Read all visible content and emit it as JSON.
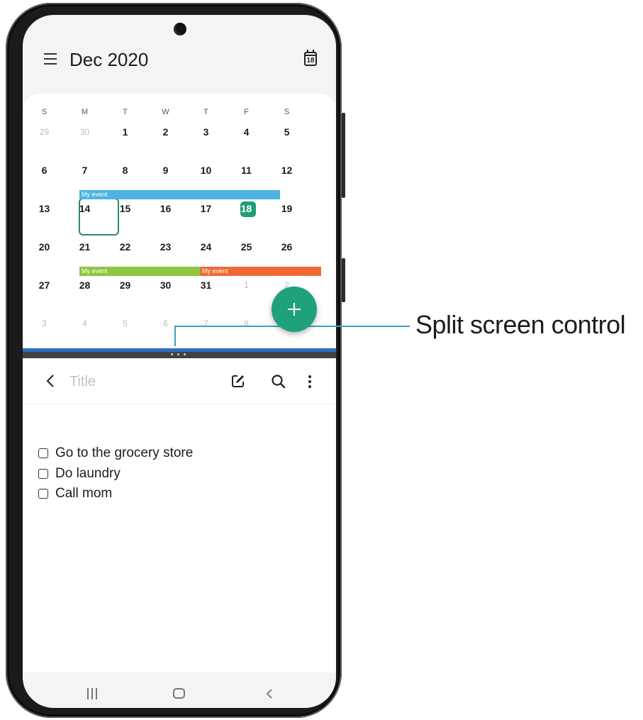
{
  "calendar": {
    "month_title": "Dec 2020",
    "today_icon_number": "18",
    "weekdays": [
      "S",
      "M",
      "T",
      "W",
      "T",
      "F",
      "S"
    ],
    "weeks": [
      [
        {
          "d": "29",
          "m": true
        },
        {
          "d": "30",
          "m": true
        },
        {
          "d": "1"
        },
        {
          "d": "2"
        },
        {
          "d": "3"
        },
        {
          "d": "4"
        },
        {
          "d": "5"
        }
      ],
      [
        {
          "d": "6"
        },
        {
          "d": "7"
        },
        {
          "d": "8"
        },
        {
          "d": "9"
        },
        {
          "d": "10"
        },
        {
          "d": "11"
        },
        {
          "d": "12"
        }
      ],
      [
        {
          "d": "13"
        },
        {
          "d": "14"
        },
        {
          "d": "15"
        },
        {
          "d": "16"
        },
        {
          "d": "17"
        },
        {
          "d": "18",
          "today": true
        },
        {
          "d": "19"
        }
      ],
      [
        {
          "d": "20"
        },
        {
          "d": "21"
        },
        {
          "d": "22"
        },
        {
          "d": "23"
        },
        {
          "d": "24"
        },
        {
          "d": "25"
        },
        {
          "d": "26"
        }
      ],
      [
        {
          "d": "27"
        },
        {
          "d": "28"
        },
        {
          "d": "29"
        },
        {
          "d": "30"
        },
        {
          "d": "31"
        },
        {
          "d": "1",
          "m": true
        },
        {
          "d": "2",
          "m": true
        }
      ],
      [
        {
          "d": "3",
          "m": true
        },
        {
          "d": "4",
          "m": true
        },
        {
          "d": "5",
          "m": true
        },
        {
          "d": "6",
          "m": true
        },
        {
          "d": "7",
          "m": true
        },
        {
          "d": "8",
          "m": true
        },
        {
          "d": "9",
          "m": true
        }
      ]
    ],
    "events": [
      {
        "label": "My event",
        "color": "#4db3e2"
      },
      {
        "label": "My event",
        "color": "#8cc63f"
      },
      {
        "label": "My event",
        "color": "#ef6a35"
      }
    ],
    "selected_day": "14",
    "today": "18",
    "accent_color": "#1fa17c"
  },
  "notes": {
    "title_placeholder": "Title",
    "items": [
      {
        "label": "Go to the grocery store",
        "checked": false
      },
      {
        "label": "Do laundry",
        "checked": false
      },
      {
        "label": "Call mom",
        "checked": false
      }
    ]
  },
  "icons": {
    "menu": "hamburger-menu-icon",
    "today": "calendar-today-icon",
    "fab": "plus-icon",
    "back": "chevron-left-icon",
    "draw": "pen-edit-icon",
    "search": "search-icon",
    "more": "more-vertical-icon",
    "nav_recents": "recents-icon",
    "nav_home": "home-icon",
    "nav_back": "back-icon"
  },
  "split_bar_color": "#2c6fc2",
  "callout": {
    "label": "Split screen control"
  }
}
